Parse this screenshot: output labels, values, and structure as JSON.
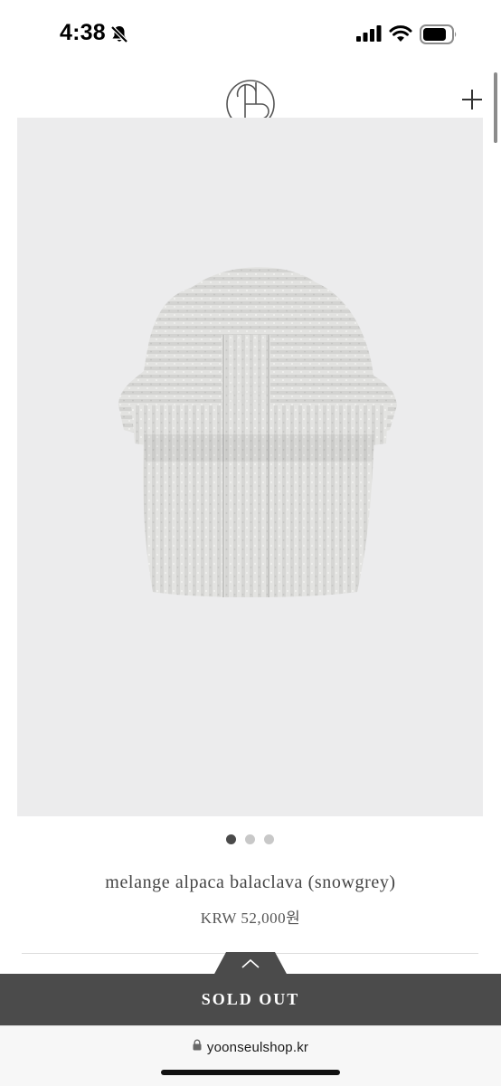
{
  "status_bar": {
    "time": "4:38",
    "icons": [
      "bell-slash-icon",
      "cellular-signal-icon",
      "wifi-icon",
      "battery-icon"
    ]
  },
  "header": {
    "logo_icon": "brand-monogram-logo",
    "menu_icon": "plus-icon"
  },
  "product": {
    "image_icon": "balaclava-photo",
    "carousel": {
      "count": 3,
      "active_index": 0
    },
    "name": "melange alpaca balaclava (snowgrey)",
    "price": "KRW 52,000원"
  },
  "purchase_bar": {
    "toggle_icon": "chevron-up-icon",
    "label": "SOLD OUT"
  },
  "browser": {
    "lock_icon": "lock-icon",
    "url": "yoonseulshop.kr"
  },
  "colors": {
    "soldout_bg": "#4b4b4b",
    "image_bg": "#ececed",
    "text_primary": "#444444",
    "dot_active": "#4a4a4a",
    "dot_inactive": "#c8c8c8"
  }
}
